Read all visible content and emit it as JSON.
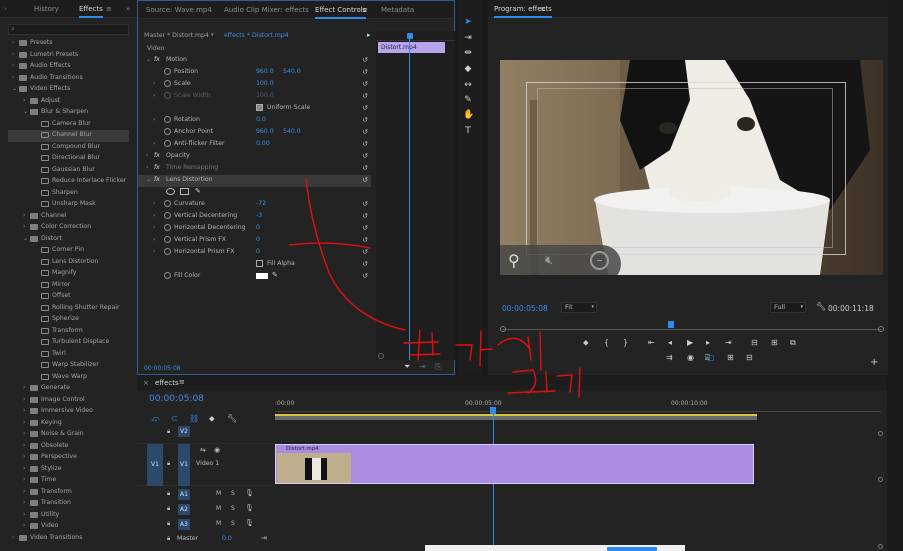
{
  "effects_panel": {
    "tabs": [
      "History",
      "Effects"
    ],
    "items": [
      {
        "label": "Presets",
        "level": 0,
        "open": false,
        "icon": "folder"
      },
      {
        "label": "Lumetri Presets",
        "level": 0,
        "open": false,
        "icon": "folder"
      },
      {
        "label": "Audio Effects",
        "level": 0,
        "open": false,
        "icon": "folder"
      },
      {
        "label": "Audio Transitions",
        "level": 0,
        "open": false,
        "icon": "folder"
      },
      {
        "label": "Video Effects",
        "level": 0,
        "open": true,
        "icon": "folder"
      },
      {
        "label": "Adjust",
        "level": 1,
        "open": false,
        "icon": "folder"
      },
      {
        "label": "Blur & Sharpen",
        "level": 1,
        "open": true,
        "icon": "folder"
      },
      {
        "label": "Camera Blur",
        "level": 2,
        "icon": "fx"
      },
      {
        "label": "Channel Blur",
        "level": 2,
        "icon": "fx",
        "selected": true
      },
      {
        "label": "Compound Blur",
        "level": 2,
        "icon": "fx"
      },
      {
        "label": "Directional Blur",
        "level": 2,
        "icon": "fx"
      },
      {
        "label": "Gaussian Blur",
        "level": 2,
        "icon": "fx"
      },
      {
        "label": "Reduce Interlace Flicker",
        "level": 2,
        "icon": "fx"
      },
      {
        "label": "Sharpen",
        "level": 2,
        "icon": "fx"
      },
      {
        "label": "Unsharp Mask",
        "level": 2,
        "icon": "fx"
      },
      {
        "label": "Channel",
        "level": 1,
        "open": false,
        "icon": "folder"
      },
      {
        "label": "Color Correction",
        "level": 1,
        "open": false,
        "icon": "folder"
      },
      {
        "label": "Distort",
        "level": 1,
        "open": true,
        "icon": "folder"
      },
      {
        "label": "Corner Pin",
        "level": 2,
        "icon": "fx"
      },
      {
        "label": "Lens Distortion",
        "level": 2,
        "icon": "fx"
      },
      {
        "label": "Magnify",
        "level": 2,
        "icon": "fx"
      },
      {
        "label": "Mirror",
        "level": 2,
        "icon": "fx"
      },
      {
        "label": "Offset",
        "level": 2,
        "icon": "fx"
      },
      {
        "label": "Rolling Shutter Repair",
        "level": 2,
        "icon": "fx"
      },
      {
        "label": "Spherize",
        "level": 2,
        "icon": "fx"
      },
      {
        "label": "Transform",
        "level": 2,
        "icon": "fx"
      },
      {
        "label": "Turbulent Displace",
        "level": 2,
        "icon": "fx"
      },
      {
        "label": "Twirl",
        "level": 2,
        "icon": "fx"
      },
      {
        "label": "Warp Stabilizer",
        "level": 2,
        "icon": "fx"
      },
      {
        "label": "Wave Warp",
        "level": 2,
        "icon": "fx"
      },
      {
        "label": "Generate",
        "level": 1,
        "open": false,
        "icon": "folder"
      },
      {
        "label": "Image Control",
        "level": 1,
        "open": false,
        "icon": "folder"
      },
      {
        "label": "Immersive Video",
        "level": 1,
        "open": false,
        "icon": "folder"
      },
      {
        "label": "Keying",
        "level": 1,
        "open": false,
        "icon": "folder"
      },
      {
        "label": "Noise & Grain",
        "level": 1,
        "open": false,
        "icon": "folder"
      },
      {
        "label": "Obsolete",
        "level": 1,
        "open": false,
        "icon": "folder"
      },
      {
        "label": "Perspective",
        "level": 1,
        "open": false,
        "icon": "folder"
      },
      {
        "label": "Stylize",
        "level": 1,
        "open": false,
        "icon": "folder"
      },
      {
        "label": "Time",
        "level": 1,
        "open": false,
        "icon": "folder"
      },
      {
        "label": "Transform",
        "level": 1,
        "open": false,
        "icon": "folder"
      },
      {
        "label": "Transition",
        "level": 1,
        "open": false,
        "icon": "folder"
      },
      {
        "label": "Utility",
        "level": 1,
        "open": false,
        "icon": "folder"
      },
      {
        "label": "Video",
        "level": 1,
        "open": false,
        "icon": "folder"
      },
      {
        "label": "Video Transitions",
        "level": 0,
        "open": false,
        "icon": "folder"
      }
    ]
  },
  "effect_controls": {
    "tabs": [
      "Source: Wave.mp4",
      "Audio Clip Mixer: effects",
      "Effect Controls",
      "Metadata"
    ],
    "master_label": "Master * Distort.mp4",
    "clip_label": "effects * Distort.mp4",
    "section_video": "Video",
    "mini_clip_label": "Distort.mp4",
    "rows": [
      {
        "kind": "fx",
        "name": "Motion",
        "indent": 0
      },
      {
        "kind": "prop",
        "name": "Position",
        "v1": "960.0",
        "v2": "540.0"
      },
      {
        "kind": "prop",
        "name": "Scale",
        "v1": "100.0",
        "twirl": true
      },
      {
        "kind": "prop",
        "name": "Scale Width",
        "v1": "100.0",
        "dim": true,
        "twirl": true
      },
      {
        "kind": "check",
        "name": "Uniform Scale"
      },
      {
        "kind": "prop",
        "name": "Rotation",
        "v1": "0.0",
        "twirl": true
      },
      {
        "kind": "prop",
        "name": "Anchor Point",
        "v1": "960.0",
        "v2": "540.0"
      },
      {
        "kind": "prop",
        "name": "Anti-flicker Filter",
        "v1": "0.00",
        "twirl": true
      },
      {
        "kind": "fx",
        "name": "Opacity",
        "indent": 0
      },
      {
        "kind": "fx",
        "name": "Time Remapping",
        "indent": 0,
        "dim": true
      },
      {
        "kind": "fx",
        "name": "Lens Distortion",
        "indent": 0,
        "selected": true
      },
      {
        "kind": "shapes"
      },
      {
        "kind": "prop",
        "name": "Curvature",
        "v1": "-72",
        "twirl": true
      },
      {
        "kind": "prop",
        "name": "Vertical Decentering",
        "v1": "-3",
        "twirl": true
      },
      {
        "kind": "prop",
        "name": "Horizontal Decentering",
        "v1": "0",
        "twirl": true
      },
      {
        "kind": "prop",
        "name": "Vertical Prism FX",
        "v1": "0",
        "twirl": true
      },
      {
        "kind": "prop",
        "name": "Horizontal Prism FX",
        "v1": "0",
        "twirl": true
      },
      {
        "kind": "check",
        "name": "Fill Alpha"
      },
      {
        "kind": "color",
        "name": "Fill Color"
      }
    ],
    "footer_time": "00:00:05:08"
  },
  "program_monitor": {
    "title": "Program: effects",
    "timecode": "00:00:05:08",
    "fit_label": "Fit",
    "quality_label": "Full",
    "duration": "00:00:11:18"
  },
  "timeline": {
    "title": "effects",
    "timecode": "00:00:05:08",
    "ruler_labels": [
      ":00:00",
      "00:00:05:00",
      "00:00:10:00"
    ],
    "tracks": [
      {
        "id": "V2",
        "type": "video"
      },
      {
        "id": "V1",
        "type": "video",
        "name": "Video 1"
      },
      {
        "id": "A1",
        "type": "audio"
      },
      {
        "id": "A2",
        "type": "audio"
      },
      {
        "id": "A3",
        "type": "audio"
      }
    ],
    "master_label": "Master",
    "master_value": "0.0",
    "clip_label": "Distort.mp4",
    "source_patch": "V1"
  },
  "colors": {
    "accent": "#2d8ceb",
    "clip_purple": "#a88de0",
    "annotation_red": "#e01010"
  }
}
